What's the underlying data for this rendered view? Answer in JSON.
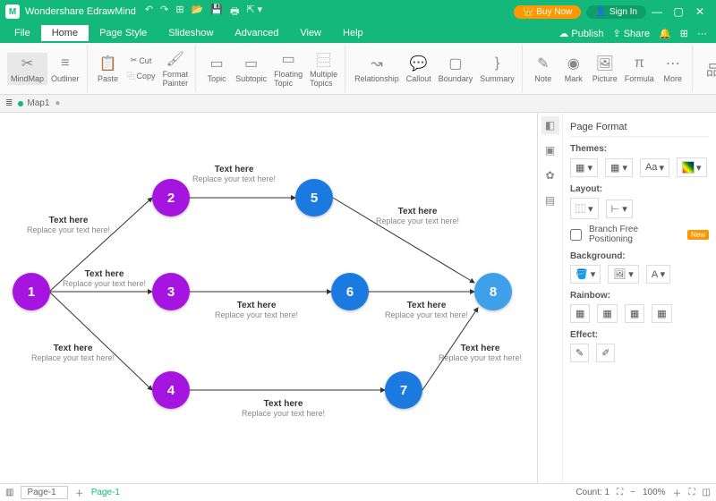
{
  "titlebar": {
    "app": "Wondershare EdrawMind",
    "buy": "Buy Now",
    "signin": "Sign In"
  },
  "menu": {
    "file": "File",
    "home": "Home",
    "pagestyle": "Page Style",
    "slideshow": "Slideshow",
    "advanced": "Advanced",
    "view": "View",
    "help": "Help",
    "publish": "Publish",
    "share": "Share"
  },
  "ribbon": {
    "mindmap": "MindMap",
    "outliner": "Outliner",
    "paste": "Paste",
    "cut": "Cut",
    "copy": "Copy",
    "formatpainter": "Format\nPainter",
    "topic": "Topic",
    "subtopic": "Subtopic",
    "floating": "Floating\nTopic",
    "multiple": "Multiple\nTopics",
    "relationship": "Relationship",
    "callout": "Callout",
    "boundary": "Boundary",
    "summary": "Summary",
    "note": "Note",
    "mark": "Mark",
    "picture": "Picture",
    "formula": "Formula",
    "more": "More"
  },
  "doc": {
    "tab": "Map1"
  },
  "nodes": {
    "n1": "1",
    "n2": "2",
    "n3": "3",
    "n4": "4",
    "n5": "5",
    "n6": "6",
    "n7": "7",
    "n8": "8",
    "label_title": "Text here",
    "label_sub": "Replace your text here!"
  },
  "side": {
    "title": "Page Format",
    "themes": "Themes:",
    "layout": "Layout:",
    "branchfree": "Branch Free Positioning",
    "new": "New",
    "background": "Background:",
    "rainbow": "Rainbow:",
    "effect": "Effect:",
    "fontA": "Aa"
  },
  "status": {
    "page": "Page-1",
    "pagename": "Page-1",
    "count": "Count:  1",
    "zoom": "100%"
  }
}
